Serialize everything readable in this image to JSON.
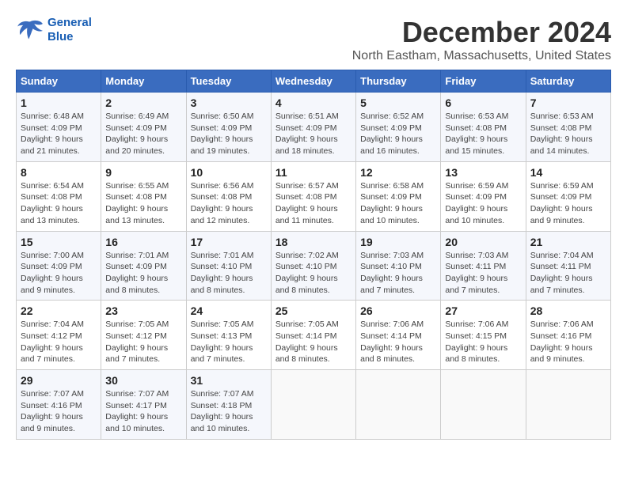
{
  "logo": {
    "line1": "General",
    "line2": "Blue"
  },
  "title": "December 2024",
  "subtitle": "North Eastham, Massachusetts, United States",
  "weekdays": [
    "Sunday",
    "Monday",
    "Tuesday",
    "Wednesday",
    "Thursday",
    "Friday",
    "Saturday"
  ],
  "weeks": [
    [
      {
        "day": "1",
        "sunrise": "6:48 AM",
        "sunset": "4:09 PM",
        "daylight": "9 hours and 21 minutes."
      },
      {
        "day": "2",
        "sunrise": "6:49 AM",
        "sunset": "4:09 PM",
        "daylight": "9 hours and 20 minutes."
      },
      {
        "day": "3",
        "sunrise": "6:50 AM",
        "sunset": "4:09 PM",
        "daylight": "9 hours and 19 minutes."
      },
      {
        "day": "4",
        "sunrise": "6:51 AM",
        "sunset": "4:09 PM",
        "daylight": "9 hours and 18 minutes."
      },
      {
        "day": "5",
        "sunrise": "6:52 AM",
        "sunset": "4:09 PM",
        "daylight": "9 hours and 16 minutes."
      },
      {
        "day": "6",
        "sunrise": "6:53 AM",
        "sunset": "4:08 PM",
        "daylight": "9 hours and 15 minutes."
      },
      {
        "day": "7",
        "sunrise": "6:53 AM",
        "sunset": "4:08 PM",
        "daylight": "9 hours and 14 minutes."
      }
    ],
    [
      {
        "day": "8",
        "sunrise": "6:54 AM",
        "sunset": "4:08 PM",
        "daylight": "9 hours and 13 minutes."
      },
      {
        "day": "9",
        "sunrise": "6:55 AM",
        "sunset": "4:08 PM",
        "daylight": "9 hours and 13 minutes."
      },
      {
        "day": "10",
        "sunrise": "6:56 AM",
        "sunset": "4:08 PM",
        "daylight": "9 hours and 12 minutes."
      },
      {
        "day": "11",
        "sunrise": "6:57 AM",
        "sunset": "4:08 PM",
        "daylight": "9 hours and 11 minutes."
      },
      {
        "day": "12",
        "sunrise": "6:58 AM",
        "sunset": "4:09 PM",
        "daylight": "9 hours and 10 minutes."
      },
      {
        "day": "13",
        "sunrise": "6:59 AM",
        "sunset": "4:09 PM",
        "daylight": "9 hours and 10 minutes."
      },
      {
        "day": "14",
        "sunrise": "6:59 AM",
        "sunset": "4:09 PM",
        "daylight": "9 hours and 9 minutes."
      }
    ],
    [
      {
        "day": "15",
        "sunrise": "7:00 AM",
        "sunset": "4:09 PM",
        "daylight": "9 hours and 9 minutes."
      },
      {
        "day": "16",
        "sunrise": "7:01 AM",
        "sunset": "4:09 PM",
        "daylight": "9 hours and 8 minutes."
      },
      {
        "day": "17",
        "sunrise": "7:01 AM",
        "sunset": "4:10 PM",
        "daylight": "9 hours and 8 minutes."
      },
      {
        "day": "18",
        "sunrise": "7:02 AM",
        "sunset": "4:10 PM",
        "daylight": "9 hours and 8 minutes."
      },
      {
        "day": "19",
        "sunrise": "7:03 AM",
        "sunset": "4:10 PM",
        "daylight": "9 hours and 7 minutes."
      },
      {
        "day": "20",
        "sunrise": "7:03 AM",
        "sunset": "4:11 PM",
        "daylight": "9 hours and 7 minutes."
      },
      {
        "day": "21",
        "sunrise": "7:04 AM",
        "sunset": "4:11 PM",
        "daylight": "9 hours and 7 minutes."
      }
    ],
    [
      {
        "day": "22",
        "sunrise": "7:04 AM",
        "sunset": "4:12 PM",
        "daylight": "9 hours and 7 minutes."
      },
      {
        "day": "23",
        "sunrise": "7:05 AM",
        "sunset": "4:12 PM",
        "daylight": "9 hours and 7 minutes."
      },
      {
        "day": "24",
        "sunrise": "7:05 AM",
        "sunset": "4:13 PM",
        "daylight": "9 hours and 7 minutes."
      },
      {
        "day": "25",
        "sunrise": "7:05 AM",
        "sunset": "4:14 PM",
        "daylight": "9 hours and 8 minutes."
      },
      {
        "day": "26",
        "sunrise": "7:06 AM",
        "sunset": "4:14 PM",
        "daylight": "9 hours and 8 minutes."
      },
      {
        "day": "27",
        "sunrise": "7:06 AM",
        "sunset": "4:15 PM",
        "daylight": "9 hours and 8 minutes."
      },
      {
        "day": "28",
        "sunrise": "7:06 AM",
        "sunset": "4:16 PM",
        "daylight": "9 hours and 9 minutes."
      }
    ],
    [
      {
        "day": "29",
        "sunrise": "7:07 AM",
        "sunset": "4:16 PM",
        "daylight": "9 hours and 9 minutes."
      },
      {
        "day": "30",
        "sunrise": "7:07 AM",
        "sunset": "4:17 PM",
        "daylight": "9 hours and 10 minutes."
      },
      {
        "day": "31",
        "sunrise": "7:07 AM",
        "sunset": "4:18 PM",
        "daylight": "9 hours and 10 minutes."
      },
      null,
      null,
      null,
      null
    ]
  ]
}
